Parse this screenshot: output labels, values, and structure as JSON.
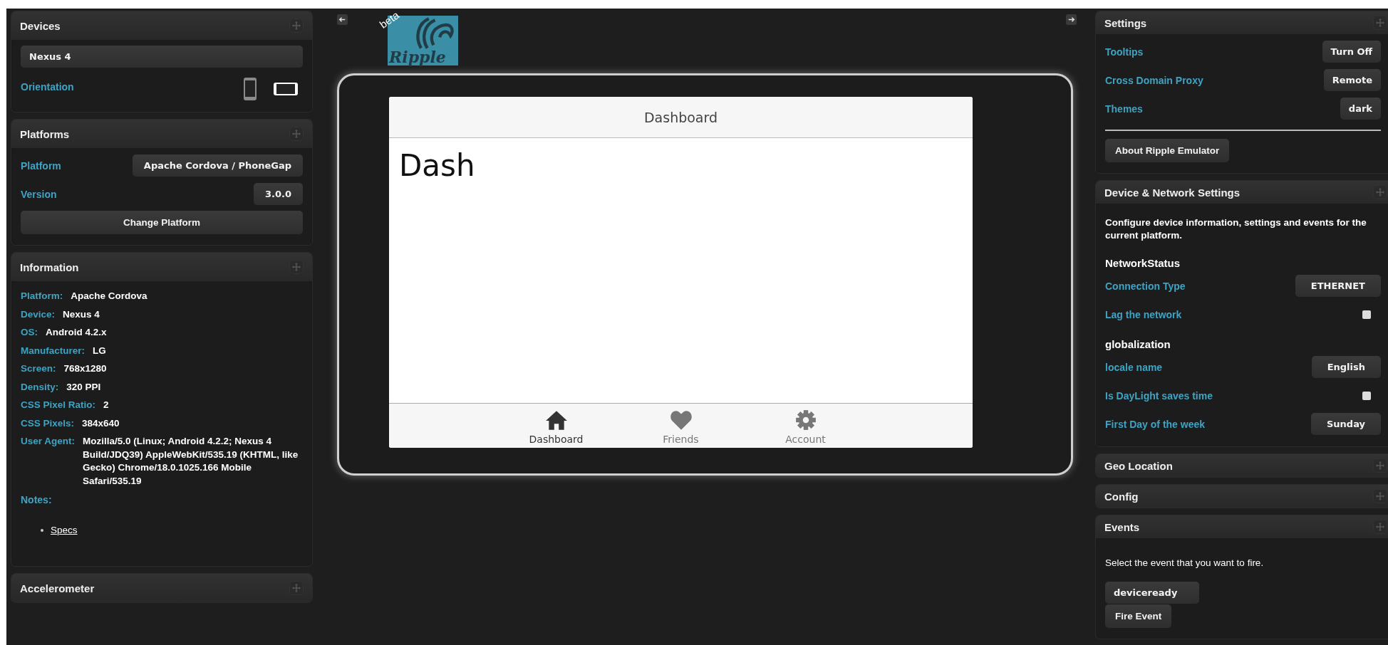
{
  "devices": {
    "title": "Devices",
    "device": "Nexus 4",
    "orientation_label": "Orientation",
    "orientations": [
      {
        "kind": "portrait",
        "selected": false
      },
      {
        "kind": "landscape",
        "selected": true
      }
    ]
  },
  "platforms": {
    "title": "Platforms",
    "rows": [
      {
        "label": "Platform",
        "value": "Apache Cordova / PhoneGap"
      },
      {
        "label": "Version",
        "value": "3.0.0"
      }
    ],
    "button": "Change Platform"
  },
  "information": {
    "title": "Information",
    "rows": [
      {
        "label": "Platform:",
        "value": "Apache Cordova"
      },
      {
        "label": "Device:",
        "value": "Nexus 4"
      },
      {
        "label": "OS:",
        "value": "Android 4.2.x"
      },
      {
        "label": "Manufacturer:",
        "value": "LG"
      },
      {
        "label": "Screen:",
        "value": "768x1280"
      },
      {
        "label": "Density:",
        "value": "320 PPI"
      },
      {
        "label": "CSS Pixel Ratio:",
        "value": "2"
      },
      {
        "label": "CSS Pixels:",
        "value": "384x640"
      },
      {
        "label": "User Agent:",
        "value": "Mozilla/5.0 (Linux; Android 4.2.2; Nexus 4 Build/JDQ39) AppleWebKit/535.19 (KHTML, like Gecko) Chrome/18.0.1025.166 Mobile Safari/535.19"
      }
    ],
    "notes_label": "Notes:",
    "links": [
      "Specs"
    ]
  },
  "accelerometer": {
    "title": "Accelerometer"
  },
  "logo": {
    "name": "Ripple",
    "badge": "beta"
  },
  "device_screen": {
    "title": "Dashboard",
    "heading": "Dash",
    "tabs": [
      {
        "kind": "home",
        "label": "Dashboard",
        "selected": true
      },
      {
        "kind": "heart",
        "label": "Friends",
        "selected": false
      },
      {
        "kind": "gear",
        "label": "Account",
        "selected": false
      }
    ]
  },
  "settings": {
    "title": "Settings",
    "rows": [
      {
        "label": "Tooltips",
        "value": "Turn Off"
      },
      {
        "label": "Cross Domain Proxy",
        "value": "Remote"
      },
      {
        "label": "Themes",
        "value": "dark"
      }
    ],
    "button": "About Ripple Emulator"
  },
  "device_network": {
    "title": "Device & Network Settings",
    "description": "Configure device information, settings and events for the current platform.",
    "sections": [
      {
        "heading": "NetworkStatus",
        "rows": [
          {
            "kind": "select",
            "label": "Connection Type",
            "value": "ETHERNET"
          },
          {
            "kind": "checkbox",
            "label": "Lag the network",
            "checked": false
          }
        ]
      },
      {
        "heading": "globalization",
        "rows": [
          {
            "kind": "select",
            "label": "locale name",
            "value": "English"
          },
          {
            "kind": "checkbox",
            "label": "Is DayLight saves time",
            "checked": false
          },
          {
            "kind": "select",
            "label": "First Day of the week",
            "value": "Sunday"
          }
        ]
      }
    ]
  },
  "collapsed_panels": [
    {
      "title": "Geo Location"
    },
    {
      "title": "Config"
    }
  ],
  "events": {
    "title": "Events",
    "description": "Select the event that you want to fire.",
    "event": "deviceready",
    "button": "Fire Event"
  }
}
